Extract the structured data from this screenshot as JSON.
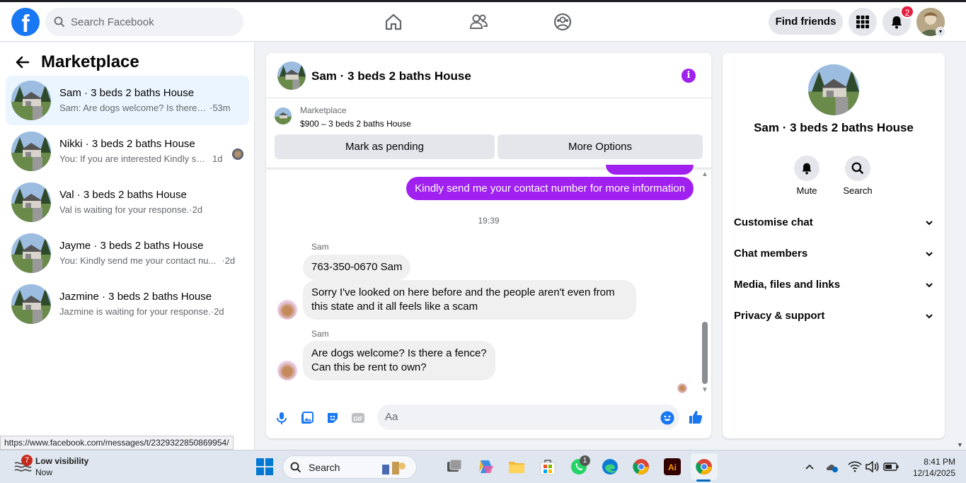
{
  "topbar": {
    "logo": "f",
    "search_placeholder": "Search Facebook",
    "find_friends_label": "Find friends",
    "notification_count": "2"
  },
  "sidebar": {
    "title": "Marketplace",
    "conversations": [
      {
        "title": "Sam · 3 beds 2 baths House",
        "snippet": "Sam: Are dogs welcome? Is there a...",
        "time": "·53m"
      },
      {
        "title": "Nikki · 3 beds 2 baths House",
        "snippet": "You: If you are interested Kindly se...",
        "time": "1d"
      },
      {
        "title": "Val · 3 beds 2 baths House",
        "snippet": "Val is waiting for your response.",
        "time": "·2d"
      },
      {
        "title": "Jayme · 3 beds 2 baths House",
        "snippet": "You: Kindly send me your contact nu...",
        "time": "·2d"
      },
      {
        "title": "Jazmine · 3 beds 2 baths House",
        "snippet": "Jazmine is waiting for your response.",
        "time": "·2d"
      }
    ]
  },
  "chat": {
    "title": "Sam · 3 beds 2 baths House",
    "marketplace_label": "Marketplace",
    "listing": "$900 – 3 beds 2 baths House",
    "mark_pending_label": "Mark as pending",
    "more_options_label": "More Options",
    "outgoing_message": "Kindly send me your contact number for more information",
    "timestamp": "19:39",
    "sender1": "Sam",
    "msg1": "763-350-0670 Sam",
    "msg2_line1": "Sorry I've looked on here before and the people aren't even from",
    "msg2_line2": "this state and it all feels like a scam",
    "sender2": "Sam",
    "msg3_line1": "Are dogs welcome? Is there a fence?",
    "msg3_line2": "Can this be rent to own?",
    "composer_placeholder": "Aa"
  },
  "info_panel": {
    "name": "Sam · 3 beds 2 baths House",
    "mute_label": "Mute",
    "search_label": "Search",
    "sections": [
      "Customise chat",
      "Chat members",
      "Media, files and links",
      "Privacy & support"
    ]
  },
  "status_url": "https://www.facebook.com/messages/t/2329322850869954/",
  "taskbar": {
    "weather_badge": "7",
    "weather_title": "Low visibility",
    "weather_sub": "Now",
    "search_label": "Search",
    "whatsapp_badge": "1",
    "time": "8:41 PM",
    "date": "12/14/2025"
  },
  "colors": {
    "facebook_blue": "#1877f2",
    "messenger_purple": "#a020f0",
    "notification_red": "#e41e3f"
  }
}
